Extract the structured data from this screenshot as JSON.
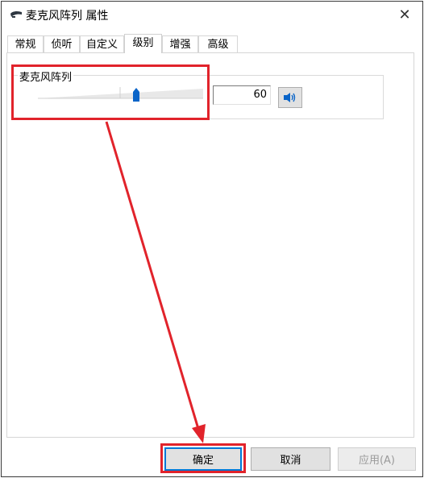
{
  "window": {
    "title": "麦克风阵列 属性",
    "close_glyph": "✕"
  },
  "tabs": [
    {
      "label": "常规"
    },
    {
      "label": "侦听"
    },
    {
      "label": "自定义"
    },
    {
      "label": "级别"
    },
    {
      "label": "增强"
    },
    {
      "label": "高级"
    }
  ],
  "active_tab": "级别",
  "levels": {
    "group_label": "麦克风阵列",
    "value_text": "60",
    "slider_level_fraction": 0.6,
    "speaker_icon": "speaker-icon"
  },
  "buttons": {
    "ok": "确定",
    "cancel": "取消",
    "apply": "应用(A)"
  },
  "colors": {
    "highlight": "#e1232b",
    "accent": "#0078d7",
    "thumb": "#0a64c8"
  }
}
